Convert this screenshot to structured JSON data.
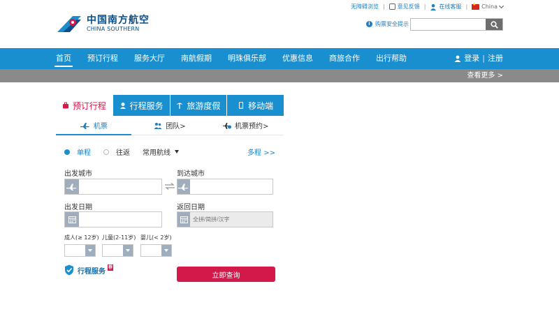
{
  "topbar": {
    "accessibility": "无障碍浏览",
    "feedback": "意见反馈",
    "online_service": "在线客服",
    "country": "China"
  },
  "logo": {
    "cn": "中国南方航空",
    "en": "CHINA SOUTHERN"
  },
  "security_tip": "购票安全提示",
  "search": {
    "placeholder": ""
  },
  "nav": {
    "items": [
      "首页",
      "预订行程",
      "服务大厅",
      "南航假期",
      "明珠俱乐部",
      "优惠信息",
      "商旅合作",
      "出行帮助"
    ],
    "login": "登录",
    "register": "注册"
  },
  "see_more": "查看更多 >",
  "booking": {
    "tabs": [
      "预订行程",
      "行程服务",
      "旅游度假",
      "移动端"
    ],
    "subtabs": [
      "机票",
      "团队>",
      "机票预约>"
    ],
    "one_way": "单程",
    "round_trip": "往返",
    "common_routes": "常用航线",
    "multi_city": "多程 >>",
    "depart_city_label": "出发城市",
    "arrive_city_label": "到达城市",
    "depart_date_label": "出发日期",
    "return_date_label": "返回日期",
    "return_placeholder": "全拼/简拼/汉字",
    "adult_label": "成人(≥ 12岁)",
    "child_label": "儿童(2-11岁)",
    "infant_label": "婴儿(< 2岁)",
    "trip_service": "行程服务",
    "recommend_badge": "荐",
    "query_button": "立即查询"
  },
  "colors": {
    "brand_blue": "#1a8fd0",
    "accent_red": "#d3194a",
    "grey_bar": "#8a8a8a"
  }
}
